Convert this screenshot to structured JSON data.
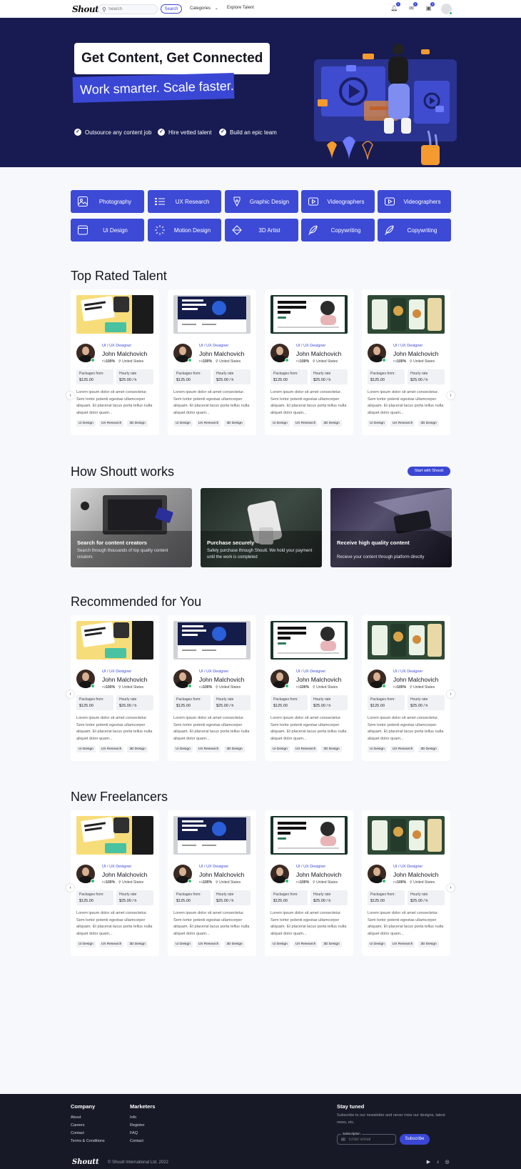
{
  "colors": {
    "brand": "#3a47d5",
    "hero_bg": "#171b52",
    "footer_bg": "#171a26",
    "online": "#2fbf71"
  },
  "nav": {
    "logo": "Shoutt",
    "search_placeholder": "Search",
    "search_button": "Search",
    "categories": "Categories",
    "explore": "Explore Talent",
    "badges": [
      "1",
      "1",
      "4"
    ]
  },
  "hero": {
    "title": "Get Content, Get Connected",
    "subtitle": "Work smarter. Scale faster.",
    "checks": [
      "Outsource any content job",
      "Hire vetted talent",
      "Build an epic team"
    ]
  },
  "categories": [
    {
      "label": "Photography",
      "icon": "image-icon"
    },
    {
      "label": "UX Research",
      "icon": "list-icon"
    },
    {
      "label": "Graphic Design",
      "icon": "pen-tool-icon"
    },
    {
      "label": "Videographers",
      "icon": "video-icon"
    },
    {
      "label": "Videographers",
      "icon": "video-icon"
    },
    {
      "label": "Ui Design",
      "icon": "browser-icon"
    },
    {
      "label": "Motion Design",
      "icon": "motion-icon"
    },
    {
      "label": "3D Artist",
      "icon": "cube-icon"
    },
    {
      "label": "Copywriting",
      "icon": "feather-icon"
    },
    {
      "label": "Copywriting",
      "icon": "feather-icon"
    }
  ],
  "card": {
    "role": "UI / UX Designer",
    "name": "John Malchovich",
    "rating": "100%",
    "country": "United States",
    "packages_label": "Packages from:",
    "packages_value": "$125.00",
    "hourly_label": "Hourly rate",
    "hourly_value": "$25.00 / h",
    "description": "Lorem ipsum dolor sit amet consectetur. Sem tortor potenti egestas ullamcorper aliquam. Et placerat lacus porta tellus nulla aliquet dolor quam...",
    "tags": [
      "Ui Design",
      "UX Research",
      "3D Design"
    ]
  },
  "sections": {
    "top_rated": "Top Rated Talent",
    "how": "How Shoutt works",
    "how_button": "Start with Shoutt",
    "recommended": "Recommended for You",
    "new_freelancers": "New Freelancers"
  },
  "how_cards": [
    {
      "title": "Search for content creators",
      "desc": "Search through thousands of top quality content creators"
    },
    {
      "title": "Purchase securely",
      "desc": "Safely purchase through Shoutt. We hold your payment until the work is completed"
    },
    {
      "title": "Receive high quality content",
      "desc": "Recieve your content through platform directly"
    }
  ],
  "footer": {
    "company_title": "Company",
    "company_links": [
      "About",
      "Careers",
      "Contact",
      "Terms & Conditions"
    ],
    "marketers_title": "Marketers",
    "marketers_links": [
      "Info",
      "Register",
      "FAQ",
      "Contact"
    ],
    "stay_title": "Stay tuned",
    "stay_text": "Subscribe to our newsletter and never miss our designs, latest news, etc.",
    "field_label": "Subscription",
    "field_placeholder": "Enter email",
    "subscribe": "Subscribe",
    "logo": "Shoutt",
    "copyright": "© Shoutt International Ltd. 2022"
  }
}
